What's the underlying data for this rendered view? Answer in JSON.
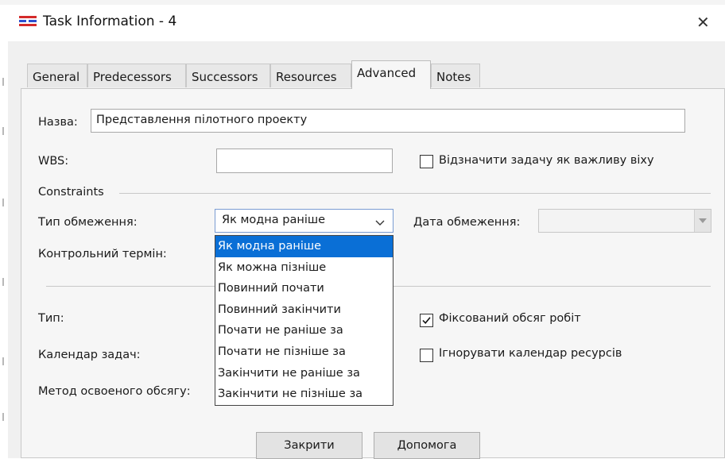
{
  "window": {
    "title": "Task Information - 4",
    "app_icon": "ganttproject-icon",
    "close_icon": "close-icon",
    "close_glyph": "✕"
  },
  "tabs": [
    {
      "label": "General",
      "active": false
    },
    {
      "label": "Predecessors",
      "active": false
    },
    {
      "label": "Successors",
      "active": false
    },
    {
      "label": "Resources",
      "active": false
    },
    {
      "label": "Advanced",
      "active": true
    },
    {
      "label": "Notes",
      "active": false
    }
  ],
  "form": {
    "name_label": "Назва:",
    "name_value": "Представлення пілотного проекту",
    "wbs_label": "WBS:",
    "wbs_value": "",
    "milestone_label": "Відзначити задачу як важливу віху",
    "milestone_checked": false,
    "constraints_heading": "Constraints",
    "constraint_type_label": "Тип обмеження:",
    "constraint_type_value": "Як модна раніше",
    "constraint_date_label": "Дата обмеження:",
    "deadline_label": "Контрольний термін:",
    "type_label": "Тип:",
    "fixed_work_label": "Фіксований обсяг робіт",
    "fixed_work_checked": true,
    "task_calendar_label": "Календар задач:",
    "ignore_calendar_label": "Ігнорувати календар ресурсів",
    "ignore_calendar_checked": false,
    "earned_value_label": "Метод освоеного обсягу:"
  },
  "dropdown": {
    "options": [
      "Як модна раніше",
      "Як можна пізніше",
      "Повинний почати",
      "Повинний закінчити",
      "Почати не раніше за",
      "Почати не пізніше за",
      "Закінчити не раніше за",
      "Закінчити не пізніше за"
    ],
    "selected_index": 0
  },
  "buttons": {
    "close_label": "Закрити",
    "help_label": "Допомога"
  },
  "colors": {
    "selection": "#0a6fd6",
    "icon_red": "#d42b2b",
    "icon_blue": "#2d4fd0"
  }
}
